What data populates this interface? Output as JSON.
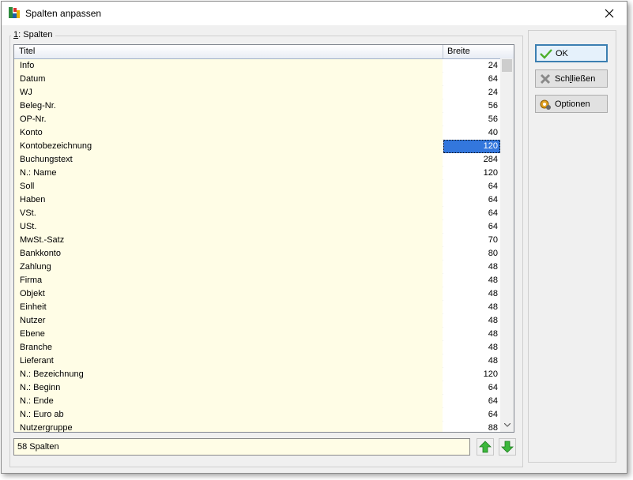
{
  "window": {
    "title": "Spalten anpassen"
  },
  "group": {
    "mnemonic": "1",
    "label_rest": ": Spalten"
  },
  "list": {
    "headers": {
      "title": "Titel",
      "width": "Breite"
    },
    "rows": [
      {
        "title": "Info",
        "width": "24"
      },
      {
        "title": "Datum",
        "width": "64"
      },
      {
        "title": "WJ",
        "width": "24"
      },
      {
        "title": "Beleg-Nr.",
        "width": "56"
      },
      {
        "title": "OP-Nr.",
        "width": "56"
      },
      {
        "title": "Konto",
        "width": "40"
      },
      {
        "title": "Kontobezeichnung",
        "width": "120",
        "selected": true
      },
      {
        "title": "Buchungstext",
        "width": "284"
      },
      {
        "title": "N.: Name",
        "width": "120"
      },
      {
        "title": "Soll",
        "width": "64"
      },
      {
        "title": "Haben",
        "width": "64"
      },
      {
        "title": "VSt.",
        "width": "64"
      },
      {
        "title": "USt.",
        "width": "64"
      },
      {
        "title": "MwSt.-Satz",
        "width": "70"
      },
      {
        "title": "Bankkonto",
        "width": "80"
      },
      {
        "title": "Zahlung",
        "width": "48"
      },
      {
        "title": "Firma",
        "width": "48"
      },
      {
        "title": "Objekt",
        "width": "48"
      },
      {
        "title": "Einheit",
        "width": "48"
      },
      {
        "title": "Nutzer",
        "width": "48"
      },
      {
        "title": "Ebene",
        "width": "48"
      },
      {
        "title": "Branche",
        "width": "48"
      },
      {
        "title": "Lieferant",
        "width": "48"
      },
      {
        "title": "N.: Bezeichnung",
        "width": "120"
      },
      {
        "title": "N.: Beginn",
        "width": "64"
      },
      {
        "title": "N.: Ende",
        "width": "64"
      },
      {
        "title": "N.: Euro ab",
        "width": "64"
      },
      {
        "title": "Nutzergruppe",
        "width": "88"
      }
    ]
  },
  "status": {
    "count_text": "58 Spalten"
  },
  "buttons": {
    "ok": {
      "label": "OK",
      "icon": "check-icon"
    },
    "close": {
      "pre": "Sch",
      "mnemonic": "l",
      "post": "ließen",
      "icon": "x-icon"
    },
    "options": {
      "label": "Optionen",
      "icon": "gear-icon"
    }
  },
  "colors": {
    "selection": "#3377dd",
    "row_bg": "#fffde6",
    "accent": "#3c7fb1"
  }
}
